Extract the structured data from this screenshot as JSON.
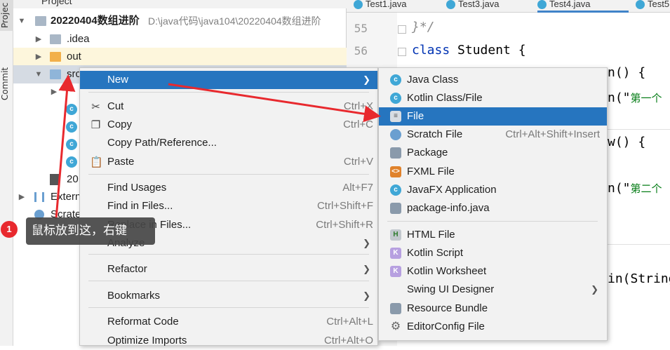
{
  "left_strip": {
    "project_tab": "Projec",
    "commit_tab": "Commit"
  },
  "project_panel": {
    "header_title": "Project",
    "tree": [
      {
        "label": "20220404数组进阶",
        "path": "D:\\java代码\\java104\\20220404数组进阶",
        "icon": "module-folder-icon"
      },
      {
        "label": ".idea",
        "icon": "folder-icon"
      },
      {
        "label": "out",
        "icon": "excluded-folder-icon"
      },
      {
        "label": "src",
        "icon": "source-folder-icon"
      },
      {
        "label": "20",
        "icon": "iml-file-icon"
      },
      {
        "label": "Extern",
        "icon": "library-icon"
      },
      {
        "label": "Scrate",
        "icon": "scratch-icon"
      }
    ]
  },
  "editor": {
    "tabs": [
      "Test1.java",
      "Test3.java",
      "Test4.java",
      "Test5"
    ],
    "active_tab": "Test4.java",
    "line_numbers": [
      "55",
      "56"
    ],
    "code": {
      "l55": "}*/",
      "l56_kw": "class",
      "l56_rest": " Student {",
      "frag1": "n() {",
      "frag2a": "n(\"",
      "frag2b": "第一个",
      "frag3": "w() {",
      "frag4a": "n(\"",
      "frag4b": "第二个",
      "frag5": "in(String"
    }
  },
  "context_menu": {
    "items": [
      {
        "label": "New",
        "has_submenu": true,
        "highlighted": true
      },
      {
        "label": "Cut",
        "shortcut": "Ctrl+X",
        "icon": "scissors-icon"
      },
      {
        "label": "Copy",
        "shortcut": "Ctrl+C",
        "icon": "copy-icon"
      },
      {
        "label": "Copy Path/Reference..."
      },
      {
        "label": "Paste",
        "shortcut": "Ctrl+V",
        "icon": "clipboard-icon"
      },
      {
        "label": "Find Usages",
        "shortcut": "Alt+F7"
      },
      {
        "label": "Find in Files...",
        "shortcut": "Ctrl+Shift+F"
      },
      {
        "label": "Replace in Files...",
        "shortcut": "Ctrl+Shift+R"
      },
      {
        "label": "Analyze",
        "has_submenu": true
      },
      {
        "label": "Refactor",
        "has_submenu": true
      },
      {
        "label": "Bookmarks",
        "has_submenu": true
      },
      {
        "label": "Reformat Code",
        "shortcut": "Ctrl+Alt+L"
      },
      {
        "label": "Optimize Imports",
        "shortcut": "Ctrl+Alt+O"
      }
    ]
  },
  "new_submenu": {
    "items": [
      {
        "label": "Java Class",
        "icon": "java-class-icon"
      },
      {
        "label": "Kotlin Class/File",
        "icon": "kotlin-class-icon"
      },
      {
        "label": "File",
        "icon": "file-icon",
        "highlighted": true
      },
      {
        "label": "Scratch File",
        "shortcut": "Ctrl+Alt+Shift+Insert",
        "icon": "scratch-file-icon"
      },
      {
        "label": "Package",
        "icon": "package-icon"
      },
      {
        "label": "FXML File",
        "icon": "fxml-file-icon"
      },
      {
        "label": "JavaFX Application",
        "icon": "javafx-icon"
      },
      {
        "label": "package-info.java",
        "icon": "package-info-icon"
      },
      {
        "label": "HTML File",
        "icon": "html-file-icon"
      },
      {
        "label": "Kotlin Script",
        "icon": "kotlin-script-icon"
      },
      {
        "label": "Kotlin Worksheet",
        "icon": "kotlin-worksheet-icon"
      },
      {
        "label": "Swing UI Designer",
        "has_submenu": true
      },
      {
        "label": "Resource Bundle",
        "icon": "resource-bundle-icon"
      },
      {
        "label": "EditorConfig File",
        "icon": "gear-icon"
      }
    ]
  },
  "annotation": {
    "badge": "1",
    "tooltip": "鼠标放到这，右键",
    "arrow_color": "#e8292e"
  },
  "colors": {
    "highlight": "#2675bf",
    "menu_bg": "#f2f2f2",
    "selection_row": "#d5dbe3"
  }
}
